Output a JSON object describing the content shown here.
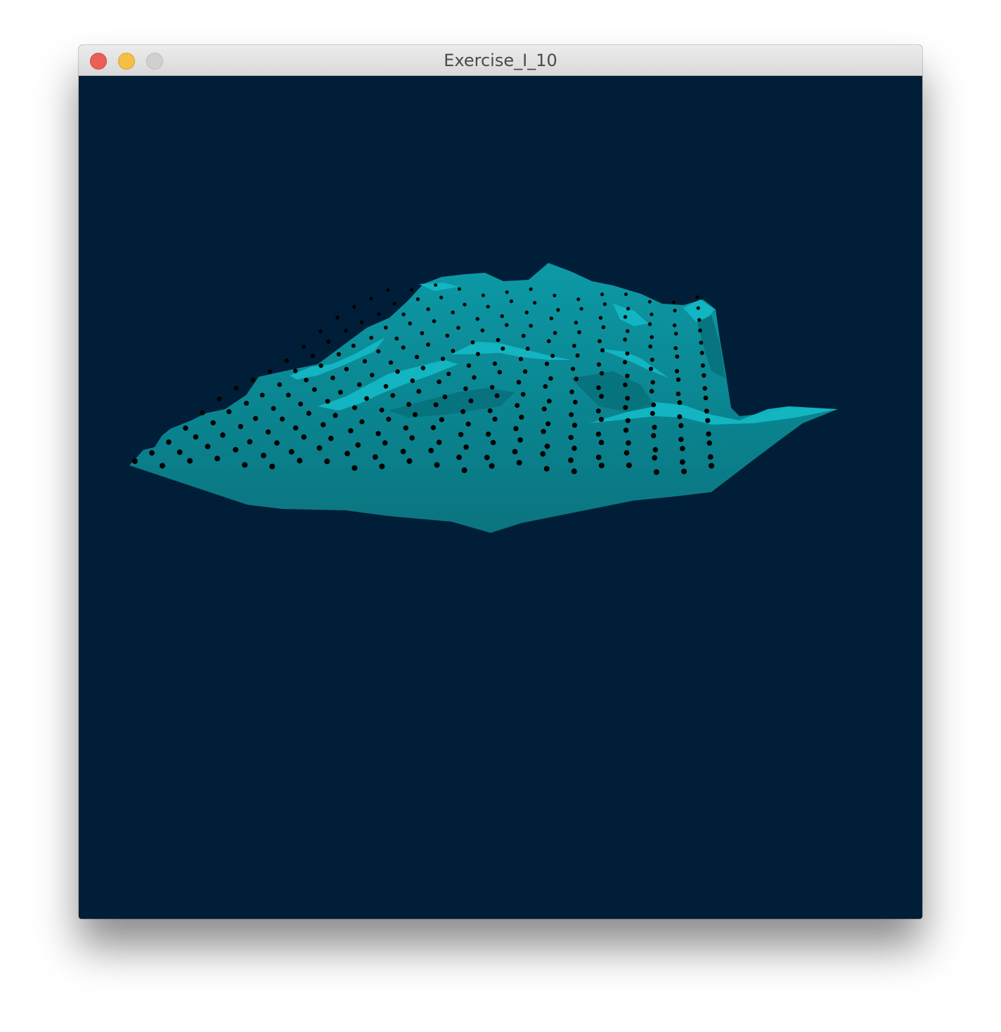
{
  "window": {
    "title": "Exercise_I_10",
    "controls": {
      "close": "close-button",
      "minimize": "minimize-button",
      "zoom": "zoom-button"
    }
  },
  "scene": {
    "background_color": "#001e38",
    "surface_color": "#0a8a96",
    "surface_highlight_color": "#19c7d2",
    "vertex_color": "#000000"
  }
}
